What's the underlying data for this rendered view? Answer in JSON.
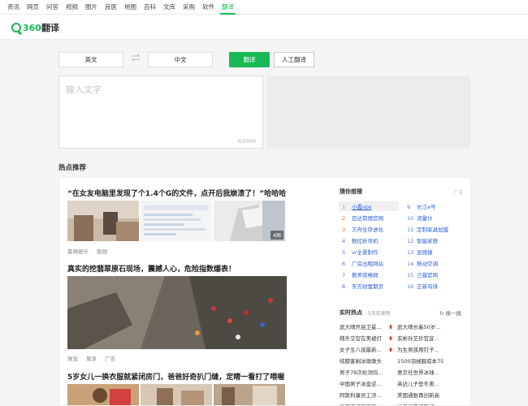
{
  "topnav": {
    "items": [
      "资讯",
      "网页",
      "问答",
      "视频",
      "图片",
      "良医",
      "地图",
      "百科",
      "文库",
      "采购",
      "软件",
      "翻译"
    ]
  },
  "logo": {
    "num": "360",
    "text": "翻译"
  },
  "translator": {
    "source_lang": "英文",
    "target_lang": "中文",
    "translate_label": "翻译",
    "human_label": "人工翻译",
    "placeholder": "输入文字",
    "char_count": "0/2000"
  },
  "hot": {
    "section_title": "热点推荐",
    "articles": [
      {
        "title": "“在女友电脑里发现了个1.4个G的文件，点开后我崩溃了！”哈哈哈",
        "tags": [
          "夏卿娱乐",
          "刚刚"
        ],
        "badge": "4图"
      },
      {
        "title": "真实的挖翡翠原石现场，震撼人心，危险指数爆表！",
        "tags": [
          "珠宝",
          "聚享",
          "广告"
        ]
      },
      {
        "title": "5岁女儿一换衣服就紧闭房门，爸爸好奇扒门缝，定睛一看打了喂喔"
      }
    ]
  },
  "guess": {
    "title": "猜你想搜",
    "ad": "广告",
    "left": [
      {
        "num": "1",
        "text": "小霞vps"
      },
      {
        "num": "2",
        "text": "百达翡丽官网"
      },
      {
        "num": "3",
        "text": "方舟生存进化"
      },
      {
        "num": "4",
        "text": "数控折弯机"
      },
      {
        "num": "5",
        "text": "vr全景制作"
      },
      {
        "num": "6",
        "text": "厂房出租网站"
      },
      {
        "num": "7",
        "text": "教师资格网"
      },
      {
        "num": "8",
        "text": "东方财富期货"
      }
    ],
    "right": [
      {
        "num": "9",
        "text": "长江e号"
      },
      {
        "num": "10",
        "text": "流量计"
      },
      {
        "num": "11",
        "text": "定制家具加盟"
      },
      {
        "num": "12",
        "text": "智能家居"
      },
      {
        "num": "13",
        "text": "显微镜"
      },
      {
        "num": "14",
        "text": "移动空调"
      },
      {
        "num": "15",
        "text": "兰蔻官网"
      },
      {
        "num": "16",
        "text": "正新鸡排"
      }
    ]
  },
  "realtime": {
    "title": "实时热点",
    "subtitle": "5天前更新",
    "refresh": "换一换",
    "left": [
      "武大晴开启卫冕...",
      "韩外交官在美被打",
      "女子生八孩最新...",
      "结膀客剩冰墩墩头",
      "男子78次检测均...",
      "中国男子冰壶逆...",
      "阿斯利康员工涉...",
      "星巴克被罚百万"
    ],
    "right": [
      "武大晴长着50岁...",
      "玄彬孙艺珍官宣...",
      "为生男孩用钉子...",
      "1500羽绒服成本75",
      "吴京任世界冰球...",
      "英达儿子登冬奥...",
      "美国通胀再创新高",
      "谷爱凌苏翊鸣纪..."
    ]
  }
}
